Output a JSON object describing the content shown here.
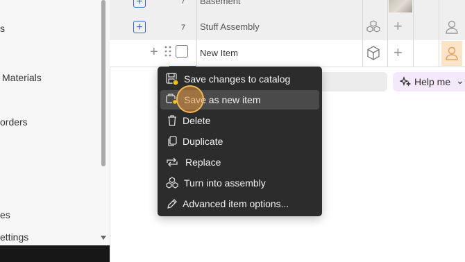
{
  "sidebar": {
    "items": [
      {
        "label": "s"
      },
      {
        "label": "Materials"
      },
      {
        "label": "orders"
      },
      {
        "label": "es"
      },
      {
        "label": "ettings"
      }
    ]
  },
  "table": {
    "rows": [
      {
        "name": "Basement",
        "number": "7"
      },
      {
        "name": "Stuff Assembly",
        "number": "7"
      },
      {
        "name": "New Item",
        "number": ""
      }
    ]
  },
  "help_button": {
    "label": "Help me"
  },
  "context_menu": {
    "items": [
      {
        "label": "Save changes to catalog",
        "icon": "save-catalog-icon"
      },
      {
        "label": "Save as new item",
        "icon": "save-new-item-icon"
      },
      {
        "label": "Delete",
        "icon": "trash-icon"
      },
      {
        "label": "Duplicate",
        "icon": "duplicate-icon"
      },
      {
        "label": "Replace",
        "icon": "replace-icon"
      },
      {
        "label": "Turn into assembly",
        "icon": "assembly-icon"
      },
      {
        "label": "Advanced item options...",
        "icon": "pencil-icon"
      }
    ],
    "hovered_index": 1
  },
  "colors": {
    "accent_blue": "#3a63c7",
    "menu_bg": "#2c2c2c",
    "help_bg": "#f4e9fb",
    "person_highlight": "#fde3c8"
  }
}
